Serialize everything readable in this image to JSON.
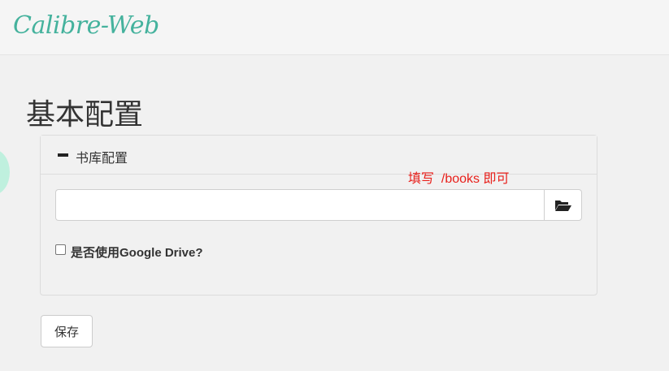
{
  "header": {
    "brand": "Calibre-Web"
  },
  "main": {
    "title": "基本配置"
  },
  "panel": {
    "heading": "书库配置",
    "path_input_value": "",
    "path_input_placeholder": "",
    "folder_icon": "folder-open-icon",
    "gdrive_checkbox_checked": false,
    "gdrive_label": "是否使用Google Drive?"
  },
  "annotation": {
    "text": "填写  /books 即可",
    "color": "#e8201b"
  },
  "actions": {
    "save_label": "保存"
  },
  "colors": {
    "brand": "#45b29d",
    "background": "#f1f1f1"
  }
}
